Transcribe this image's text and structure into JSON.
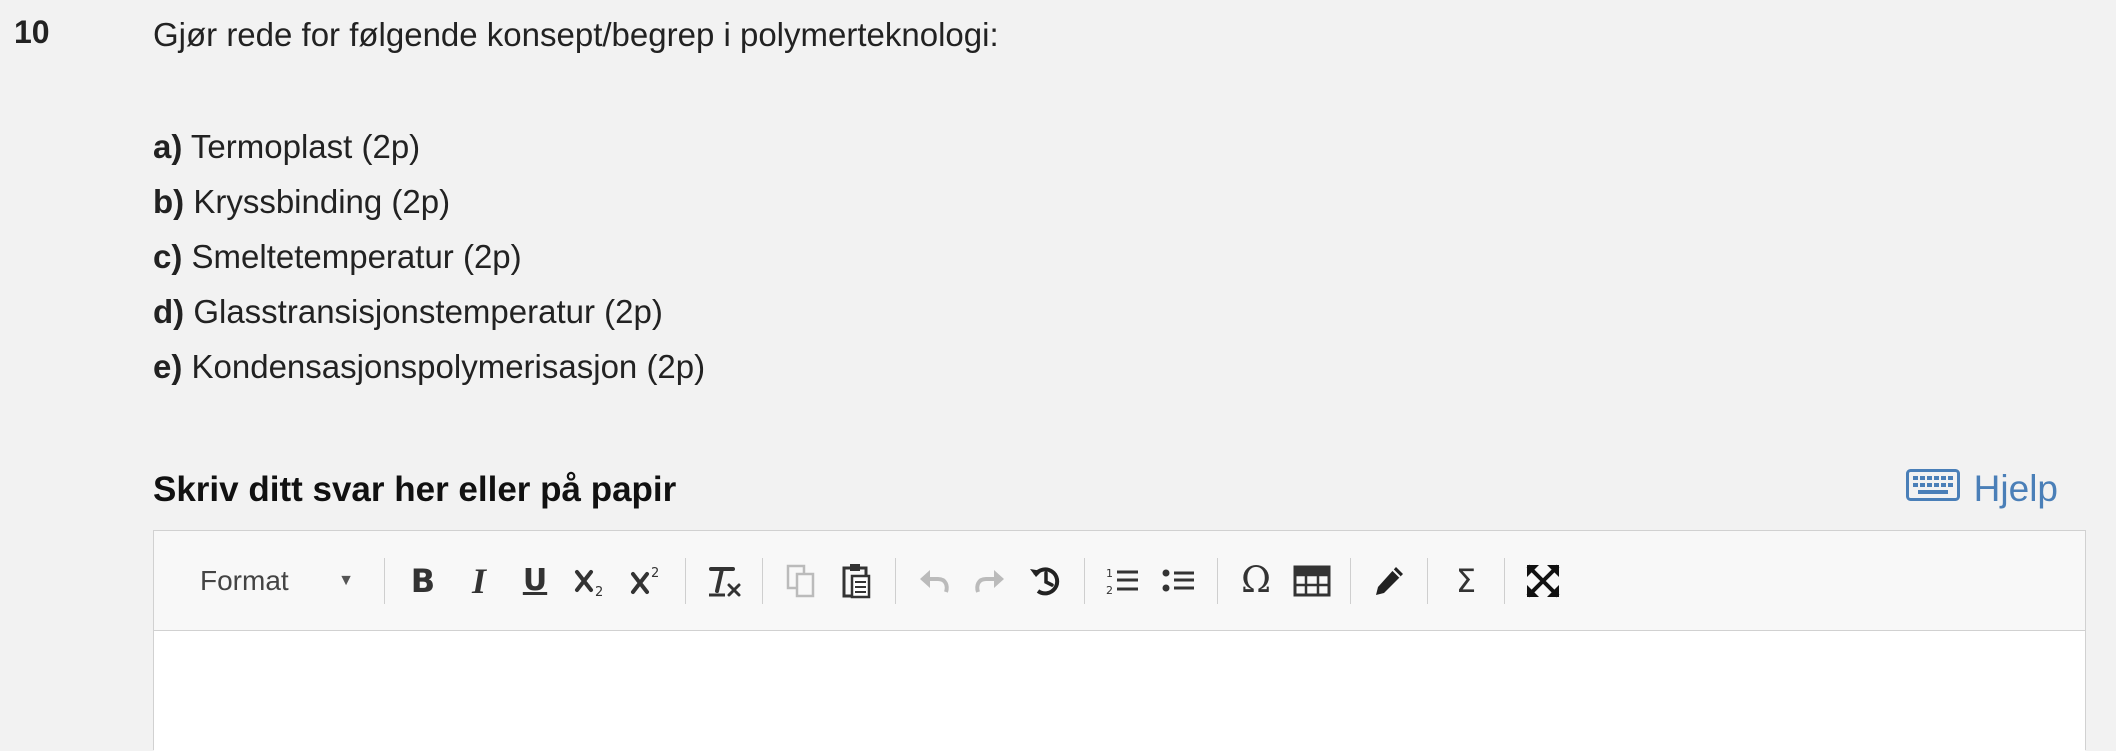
{
  "question": {
    "number": "10",
    "prompt": "Gjør rede for følgende konsept/begrep i polymerteknologi:",
    "items": [
      {
        "letter": "a)",
        "text": " Termoplast (2p)"
      },
      {
        "letter": "b)",
        "text": " Kryssbinding (2p)"
      },
      {
        "letter": "c)",
        "text": " Smeltetemperatur (2p)"
      },
      {
        "letter": "d)",
        "text": " Glasstransisjonstemperatur (2p)"
      },
      {
        "letter": "e)",
        "text": " Kondensasjonspolymerisasjon (2p)"
      }
    ]
  },
  "answer": {
    "label": "Skriv ditt svar her eller på papir",
    "help_label": "Hjelp",
    "help_icon": "keyboard-icon"
  },
  "toolbar": {
    "format_label": "Format",
    "buttons": [
      {
        "name": "bold",
        "icon": "bold-icon",
        "enabled": true
      },
      {
        "name": "italic",
        "icon": "italic-icon",
        "enabled": true
      },
      {
        "name": "underline",
        "icon": "underline-icon",
        "enabled": true
      },
      {
        "name": "subscript",
        "icon": "subscript-icon",
        "enabled": true
      },
      {
        "name": "superscript",
        "icon": "superscript-icon",
        "enabled": true
      },
      {
        "name": "remove-format",
        "icon": "remove-format-icon",
        "enabled": true
      },
      {
        "name": "copy",
        "icon": "copy-icon",
        "enabled": false
      },
      {
        "name": "paste",
        "icon": "paste-icon",
        "enabled": true
      },
      {
        "name": "undo",
        "icon": "undo-icon",
        "enabled": false
      },
      {
        "name": "redo",
        "icon": "redo-icon",
        "enabled": false
      },
      {
        "name": "history",
        "icon": "history-icon",
        "enabled": true
      },
      {
        "name": "numbered-list",
        "icon": "numbered-list-icon",
        "enabled": true
      },
      {
        "name": "bulleted-list",
        "icon": "bulleted-list-icon",
        "enabled": true
      },
      {
        "name": "special-character",
        "icon": "omega-icon",
        "enabled": true
      },
      {
        "name": "table",
        "icon": "table-icon",
        "enabled": true
      },
      {
        "name": "draw",
        "icon": "pencil-icon",
        "enabled": true
      },
      {
        "name": "math",
        "icon": "sigma-icon",
        "enabled": true
      },
      {
        "name": "maximize",
        "icon": "maximize-icon",
        "enabled": true
      }
    ]
  },
  "colors": {
    "background": "#f2f2f2",
    "link": "#4a7fb8",
    "editor_bg": "#ffffff",
    "toolbar_bg": "#f8f8f8"
  }
}
